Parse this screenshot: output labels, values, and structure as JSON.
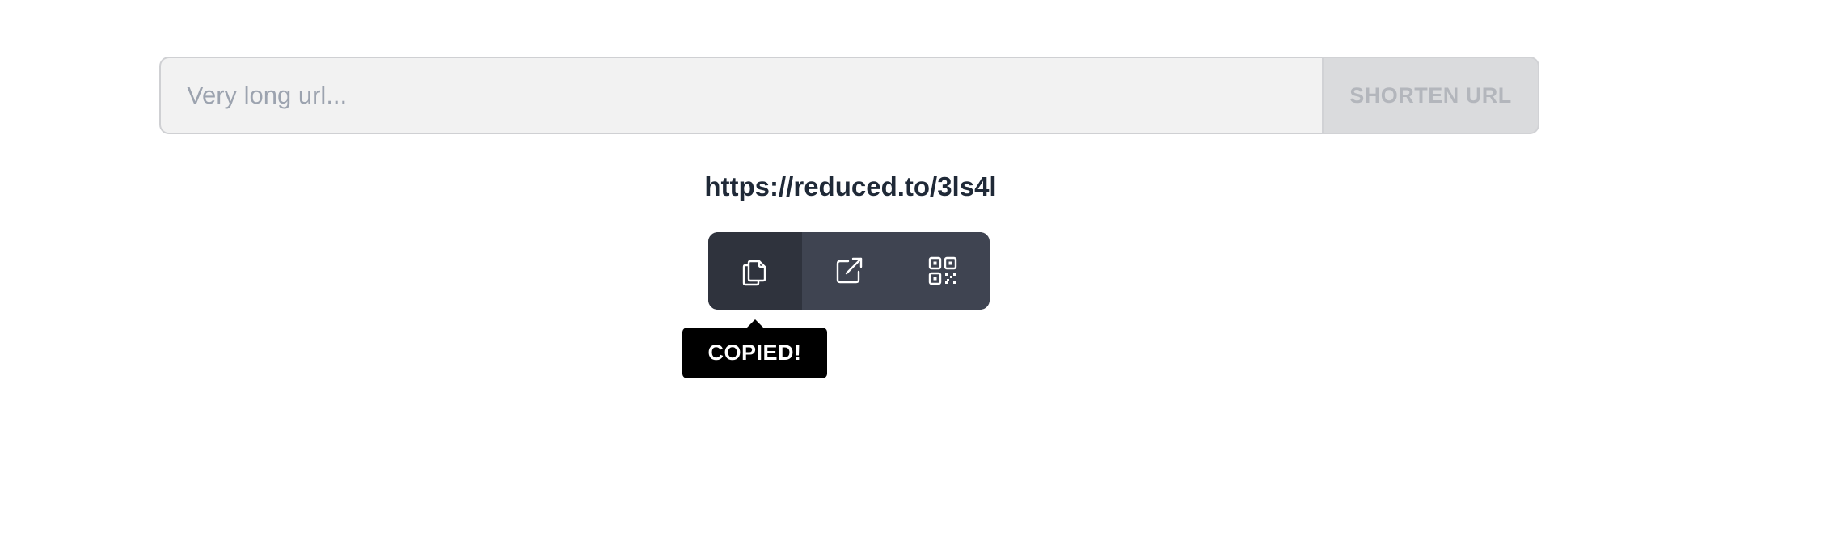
{
  "form": {
    "input_placeholder": "Very long url...",
    "input_value": "",
    "shorten_label": "SHORTEN URL"
  },
  "result": {
    "short_url": "https://reduced.to/3ls4l"
  },
  "actions": [
    {
      "name": "copy",
      "icon": "copy-icon",
      "active": true
    },
    {
      "name": "open",
      "icon": "external-link-icon",
      "active": false
    },
    {
      "name": "qr",
      "icon": "qr-code-icon",
      "active": false
    }
  ],
  "tooltip": {
    "text": "COPIED!"
  },
  "colors": {
    "input_bg": "#f2f2f2",
    "button_bg": "#dadbdd",
    "button_text": "#b3b6bc",
    "action_bar_bg": "#3f4451",
    "action_active_bg": "#2f333d",
    "tooltip_bg": "#000000",
    "url_text": "#1f2937"
  }
}
